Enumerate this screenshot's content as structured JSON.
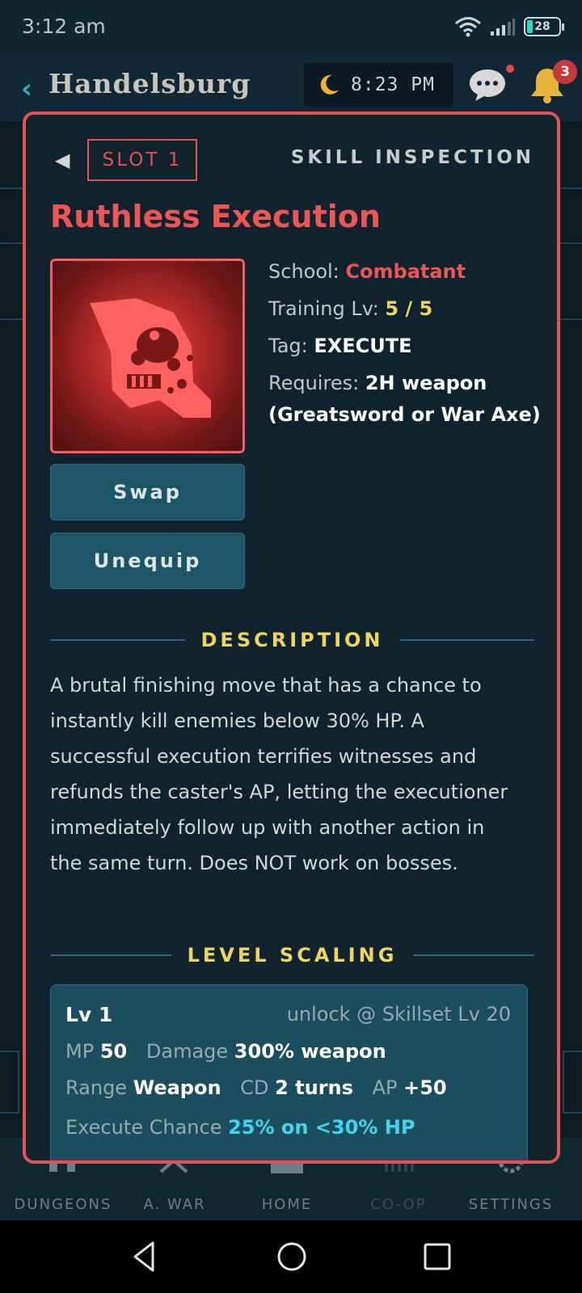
{
  "status_bar": {
    "time": "3:12 am",
    "battery": "28"
  },
  "header": {
    "back_icon": "chevron-left-icon",
    "town": "Handelsburg",
    "clock": "8:23 PM",
    "clock_icon": "moon-icon",
    "notification_count": "3"
  },
  "modal": {
    "back_icon": "triangle-left-icon",
    "slot_label": "SLOT 1",
    "header_title": "SKILL INSPECTION",
    "skill_name": "Ruthless Execution",
    "skill_icon": "skull-blade-icon",
    "school_label": "School:",
    "school_value": "Combatant",
    "training_label": "Training Lv:",
    "training_value": "5 / 5",
    "tag_label": "Tag:",
    "tag_value": "EXECUTE",
    "requires_label": "Requires:",
    "requires_value_1": "2H weapon",
    "requires_value_2": "(Greatsword or War Axe)",
    "swap_label": "Swap",
    "unequip_label": "Unequip",
    "description_title": "DESCRIPTION",
    "description": "A brutal finishing move that has a chance to instantly kill enemies below 30% HP. A successful execution terrifies witnesses and refunds the caster's AP, letting the executioner immediately follow up with another action in the same turn. Does NOT work on bosses.",
    "scaling_title": "LEVEL SCALING",
    "scaling": {
      "level": "Lv 1",
      "unlock": "unlock @ Skillset Lv 20",
      "mp_label": "MP",
      "mp_value": "50",
      "damage_label": "Damage",
      "damage_value": "300% weapon",
      "range_label": "Range",
      "range_value": "Weapon",
      "cd_label": "CD",
      "cd_value": "2 turns",
      "ap_label": "AP",
      "ap_value": "+50",
      "execute_label": "Execute Chance",
      "execute_value": "25% on <30% HP"
    }
  },
  "bottom_nav": [
    {
      "label": "DUNGEONS",
      "icon": "dungeon-icon"
    },
    {
      "label": "A. WAR",
      "icon": "crossed-swords-icon"
    },
    {
      "label": "HOME",
      "icon": "castle-icon"
    },
    {
      "label": "CO-OP",
      "icon": "gate-icon"
    },
    {
      "label": "SETTINGS",
      "icon": "gear-icon"
    }
  ],
  "colors": {
    "accent_red": "#e25454",
    "accent_yellow": "#ecd75c",
    "accent_cyan": "#46d3ec",
    "button_teal": "#1b5566"
  }
}
